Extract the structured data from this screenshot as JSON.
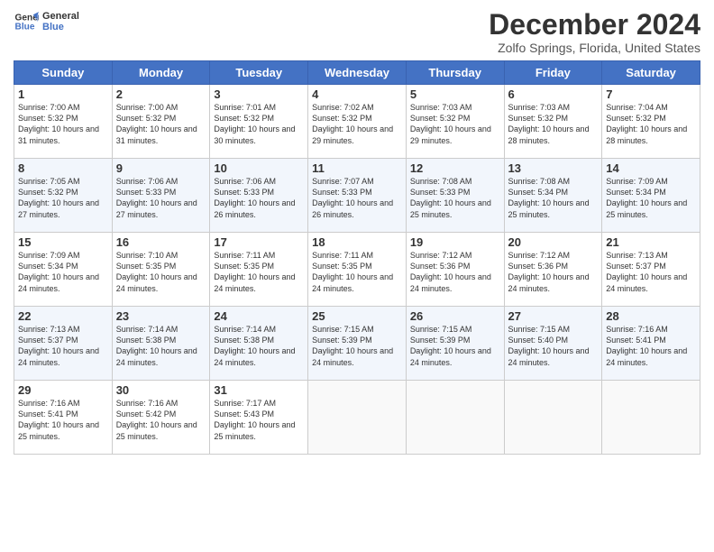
{
  "header": {
    "logo_line1": "General",
    "logo_line2": "Blue",
    "month_title": "December 2024",
    "location": "Zolfo Springs, Florida, United States"
  },
  "weekdays": [
    "Sunday",
    "Monday",
    "Tuesday",
    "Wednesday",
    "Thursday",
    "Friday",
    "Saturday"
  ],
  "weeks": [
    [
      {
        "day": "1",
        "sunrise": "7:00 AM",
        "sunset": "5:32 PM",
        "daylight": "10 hours and 31 minutes."
      },
      {
        "day": "2",
        "sunrise": "7:00 AM",
        "sunset": "5:32 PM",
        "daylight": "10 hours and 31 minutes."
      },
      {
        "day": "3",
        "sunrise": "7:01 AM",
        "sunset": "5:32 PM",
        "daylight": "10 hours and 30 minutes."
      },
      {
        "day": "4",
        "sunrise": "7:02 AM",
        "sunset": "5:32 PM",
        "daylight": "10 hours and 29 minutes."
      },
      {
        "day": "5",
        "sunrise": "7:03 AM",
        "sunset": "5:32 PM",
        "daylight": "10 hours and 29 minutes."
      },
      {
        "day": "6",
        "sunrise": "7:03 AM",
        "sunset": "5:32 PM",
        "daylight": "10 hours and 28 minutes."
      },
      {
        "day": "7",
        "sunrise": "7:04 AM",
        "sunset": "5:32 PM",
        "daylight": "10 hours and 28 minutes."
      }
    ],
    [
      {
        "day": "8",
        "sunrise": "7:05 AM",
        "sunset": "5:32 PM",
        "daylight": "10 hours and 27 minutes."
      },
      {
        "day": "9",
        "sunrise": "7:06 AM",
        "sunset": "5:33 PM",
        "daylight": "10 hours and 27 minutes."
      },
      {
        "day": "10",
        "sunrise": "7:06 AM",
        "sunset": "5:33 PM",
        "daylight": "10 hours and 26 minutes."
      },
      {
        "day": "11",
        "sunrise": "7:07 AM",
        "sunset": "5:33 PM",
        "daylight": "10 hours and 26 minutes."
      },
      {
        "day": "12",
        "sunrise": "7:08 AM",
        "sunset": "5:33 PM",
        "daylight": "10 hours and 25 minutes."
      },
      {
        "day": "13",
        "sunrise": "7:08 AM",
        "sunset": "5:34 PM",
        "daylight": "10 hours and 25 minutes."
      },
      {
        "day": "14",
        "sunrise": "7:09 AM",
        "sunset": "5:34 PM",
        "daylight": "10 hours and 25 minutes."
      }
    ],
    [
      {
        "day": "15",
        "sunrise": "7:09 AM",
        "sunset": "5:34 PM",
        "daylight": "10 hours and 24 minutes."
      },
      {
        "day": "16",
        "sunrise": "7:10 AM",
        "sunset": "5:35 PM",
        "daylight": "10 hours and 24 minutes."
      },
      {
        "day": "17",
        "sunrise": "7:11 AM",
        "sunset": "5:35 PM",
        "daylight": "10 hours and 24 minutes."
      },
      {
        "day": "18",
        "sunrise": "7:11 AM",
        "sunset": "5:35 PM",
        "daylight": "10 hours and 24 minutes."
      },
      {
        "day": "19",
        "sunrise": "7:12 AM",
        "sunset": "5:36 PM",
        "daylight": "10 hours and 24 minutes."
      },
      {
        "day": "20",
        "sunrise": "7:12 AM",
        "sunset": "5:36 PM",
        "daylight": "10 hours and 24 minutes."
      },
      {
        "day": "21",
        "sunrise": "7:13 AM",
        "sunset": "5:37 PM",
        "daylight": "10 hours and 24 minutes."
      }
    ],
    [
      {
        "day": "22",
        "sunrise": "7:13 AM",
        "sunset": "5:37 PM",
        "daylight": "10 hours and 24 minutes."
      },
      {
        "day": "23",
        "sunrise": "7:14 AM",
        "sunset": "5:38 PM",
        "daylight": "10 hours and 24 minutes."
      },
      {
        "day": "24",
        "sunrise": "7:14 AM",
        "sunset": "5:38 PM",
        "daylight": "10 hours and 24 minutes."
      },
      {
        "day": "25",
        "sunrise": "7:15 AM",
        "sunset": "5:39 PM",
        "daylight": "10 hours and 24 minutes."
      },
      {
        "day": "26",
        "sunrise": "7:15 AM",
        "sunset": "5:39 PM",
        "daylight": "10 hours and 24 minutes."
      },
      {
        "day": "27",
        "sunrise": "7:15 AM",
        "sunset": "5:40 PM",
        "daylight": "10 hours and 24 minutes."
      },
      {
        "day": "28",
        "sunrise": "7:16 AM",
        "sunset": "5:41 PM",
        "daylight": "10 hours and 24 minutes."
      }
    ],
    [
      {
        "day": "29",
        "sunrise": "7:16 AM",
        "sunset": "5:41 PM",
        "daylight": "10 hours and 25 minutes."
      },
      {
        "day": "30",
        "sunrise": "7:16 AM",
        "sunset": "5:42 PM",
        "daylight": "10 hours and 25 minutes."
      },
      {
        "day": "31",
        "sunrise": "7:17 AM",
        "sunset": "5:43 PM",
        "daylight": "10 hours and 25 minutes."
      },
      null,
      null,
      null,
      null
    ]
  ]
}
